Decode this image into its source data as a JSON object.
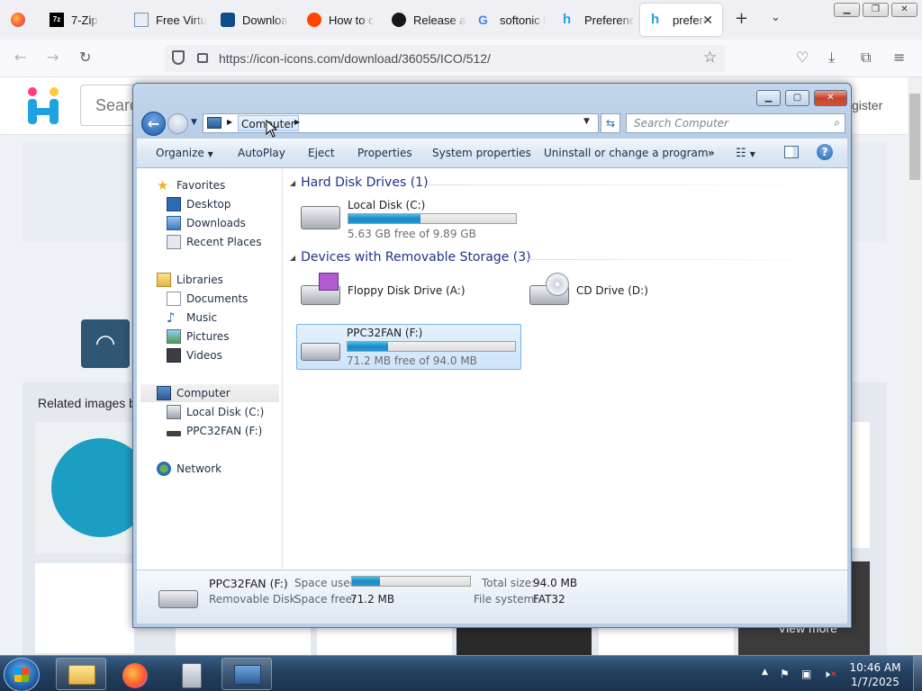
{
  "browser": {
    "tabs": [
      {
        "title": "7-Zip"
      },
      {
        "title": "Free Virtu"
      },
      {
        "title": "Downloa"
      },
      {
        "title": "How to c"
      },
      {
        "title": "Release a"
      },
      {
        "title": "softonic l"
      },
      {
        "title": "Preferenc"
      },
      {
        "title": "prefere",
        "active": true
      }
    ],
    "url": "https://icon-icons.com/download/36055/ICO/512/"
  },
  "website": {
    "search_placeholder": "Searc",
    "register": "gister",
    "related_label": "Related images b",
    "view_more": "View more"
  },
  "explorer": {
    "breadcrumb": "Computer",
    "search_placeholder": "Search Computer",
    "commands": [
      "Organize",
      "AutoPlay",
      "Eject",
      "Properties",
      "System properties",
      "Uninstall or change a program"
    ],
    "nav": {
      "favorites": "Favorites",
      "desktop": "Desktop",
      "downloads": "Downloads",
      "recent_places": "Recent Places",
      "libraries": "Libraries",
      "documents": "Documents",
      "music": "Music",
      "pictures": "Pictures",
      "videos": "Videos",
      "computer": "Computer",
      "local_disk": "Local Disk (C:)",
      "ppc32fan": "PPC32FAN (F:)",
      "network": "Network"
    },
    "groups": {
      "hdd": "Hard Disk Drives (1)",
      "removable": "Devices with Removable Storage (3)"
    },
    "drives": {
      "c": {
        "name": "Local Disk (C:)",
        "free": "5.63 GB free of 9.89 GB",
        "used_fraction": 0.43
      },
      "a": {
        "name": "Floppy Disk Drive (A:)"
      },
      "d": {
        "name": "CD Drive (D:)"
      },
      "f": {
        "name": "PPC32FAN (F:)",
        "free": "71.2 MB free of 94.0 MB",
        "used_fraction": 0.24
      }
    },
    "details": {
      "name": "PPC32FAN (F:)",
      "type": "Removable Disk",
      "space_used_label": "Space used:",
      "space_used_fraction": 0.24,
      "space_free_label": "Space free:",
      "space_free": "71.2 MB",
      "total_size_label": "Total size:",
      "total_size": "94.0 MB",
      "file_system_label": "File system:",
      "file_system": "FAT32"
    }
  },
  "taskbar": {
    "time": "10:46 AM",
    "date": "1/7/2025"
  },
  "colors": {
    "accent": "#1b89c8",
    "selection": "#cde4fa",
    "taskbar": "#23405f"
  }
}
